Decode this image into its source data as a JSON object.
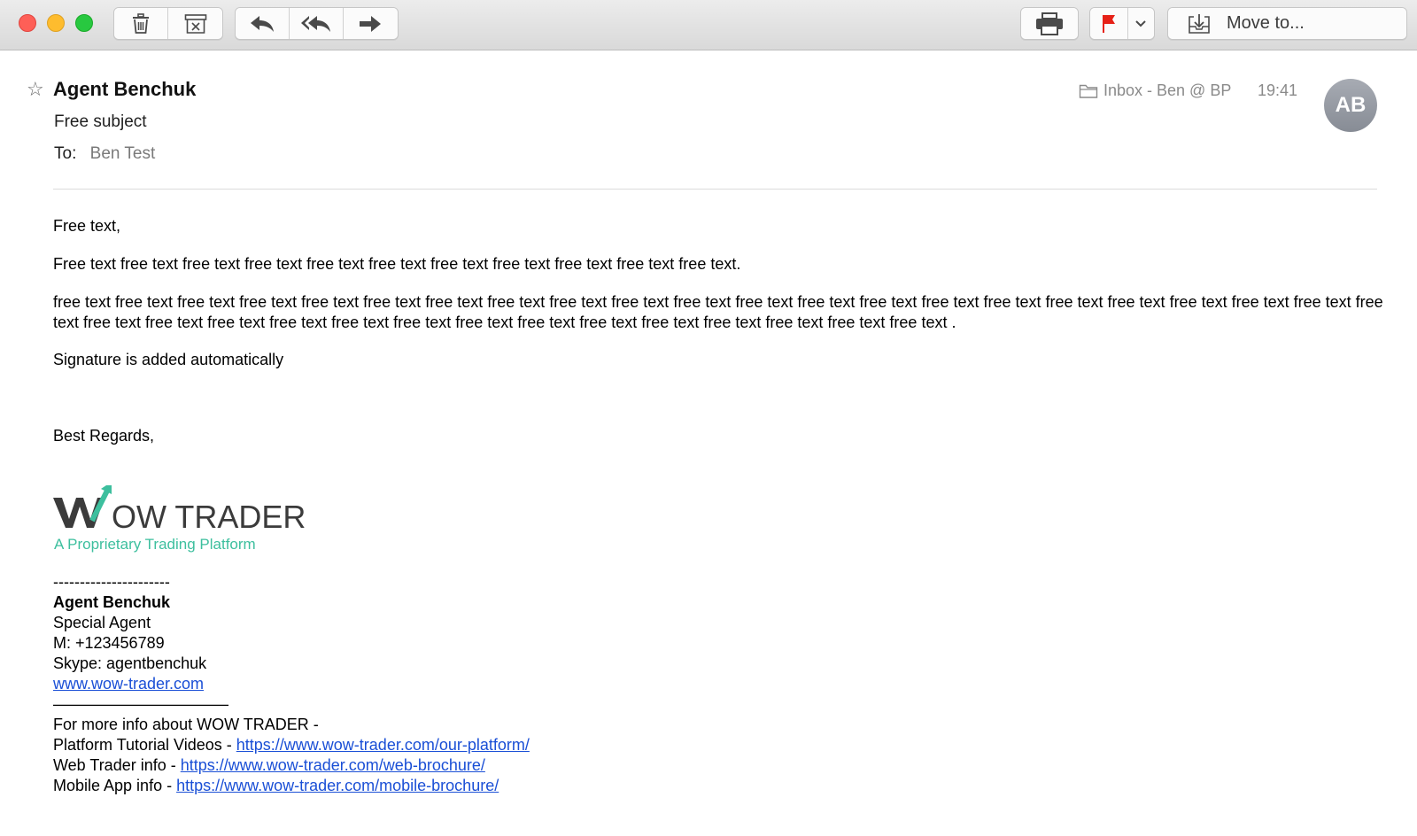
{
  "window": {
    "toolbar": {
      "move_label": "Move to..."
    }
  },
  "header": {
    "sender": "Agent Benchuk",
    "subject": "Free subject",
    "to_label": "To:",
    "to_value": "Ben Test",
    "mailbox": "Inbox - Ben @ BP",
    "time": "19:41",
    "avatar_initials": "AB"
  },
  "body": {
    "greeting": "Free text,",
    "para1": "Free text free text free text free text free text free text free text free text free text free text free text.",
    "para2": "free text free text free text free text free text free text free text free text free text free text free text free text free text free text free text free text free text free text free text free text free text free text free text free text free text free text free text free text free text free text free text free text free text free text free text free text .",
    "signature_note": "Signature is added automatically",
    "regards": "Best Regards,"
  },
  "logo": {
    "brand_wordmark": "OW TRADER",
    "tagline": "A Proprietary Trading Platform",
    "colors": {
      "dark": "#3b3b3b",
      "accent": "#3dbf9e"
    }
  },
  "signature": {
    "separator1": "----------------------",
    "name": "Agent Benchuk",
    "title": "Special Agent",
    "mobile": "M: +123456789",
    "skype": "Skype: agentbenchuk",
    "website": "www.wow-trader.com",
    "separator2": "———————————",
    "more_info": "For more info about WOW TRADER -",
    "links": [
      {
        "label": "Platform Tutorial Videos - ",
        "url": "https://www.wow-trader.com/our-platform/"
      },
      {
        "label": "Web Trader info - ",
        "url": "https://www.wow-trader.com/web-brochure/"
      },
      {
        "label": "Mobile App info - ",
        "url": "https://www.wow-trader.com/mobile-brochure/"
      }
    ]
  },
  "colors": {
    "link": "#1a4fd6",
    "flag": "#e62117",
    "muted": "#8a8a8a"
  }
}
